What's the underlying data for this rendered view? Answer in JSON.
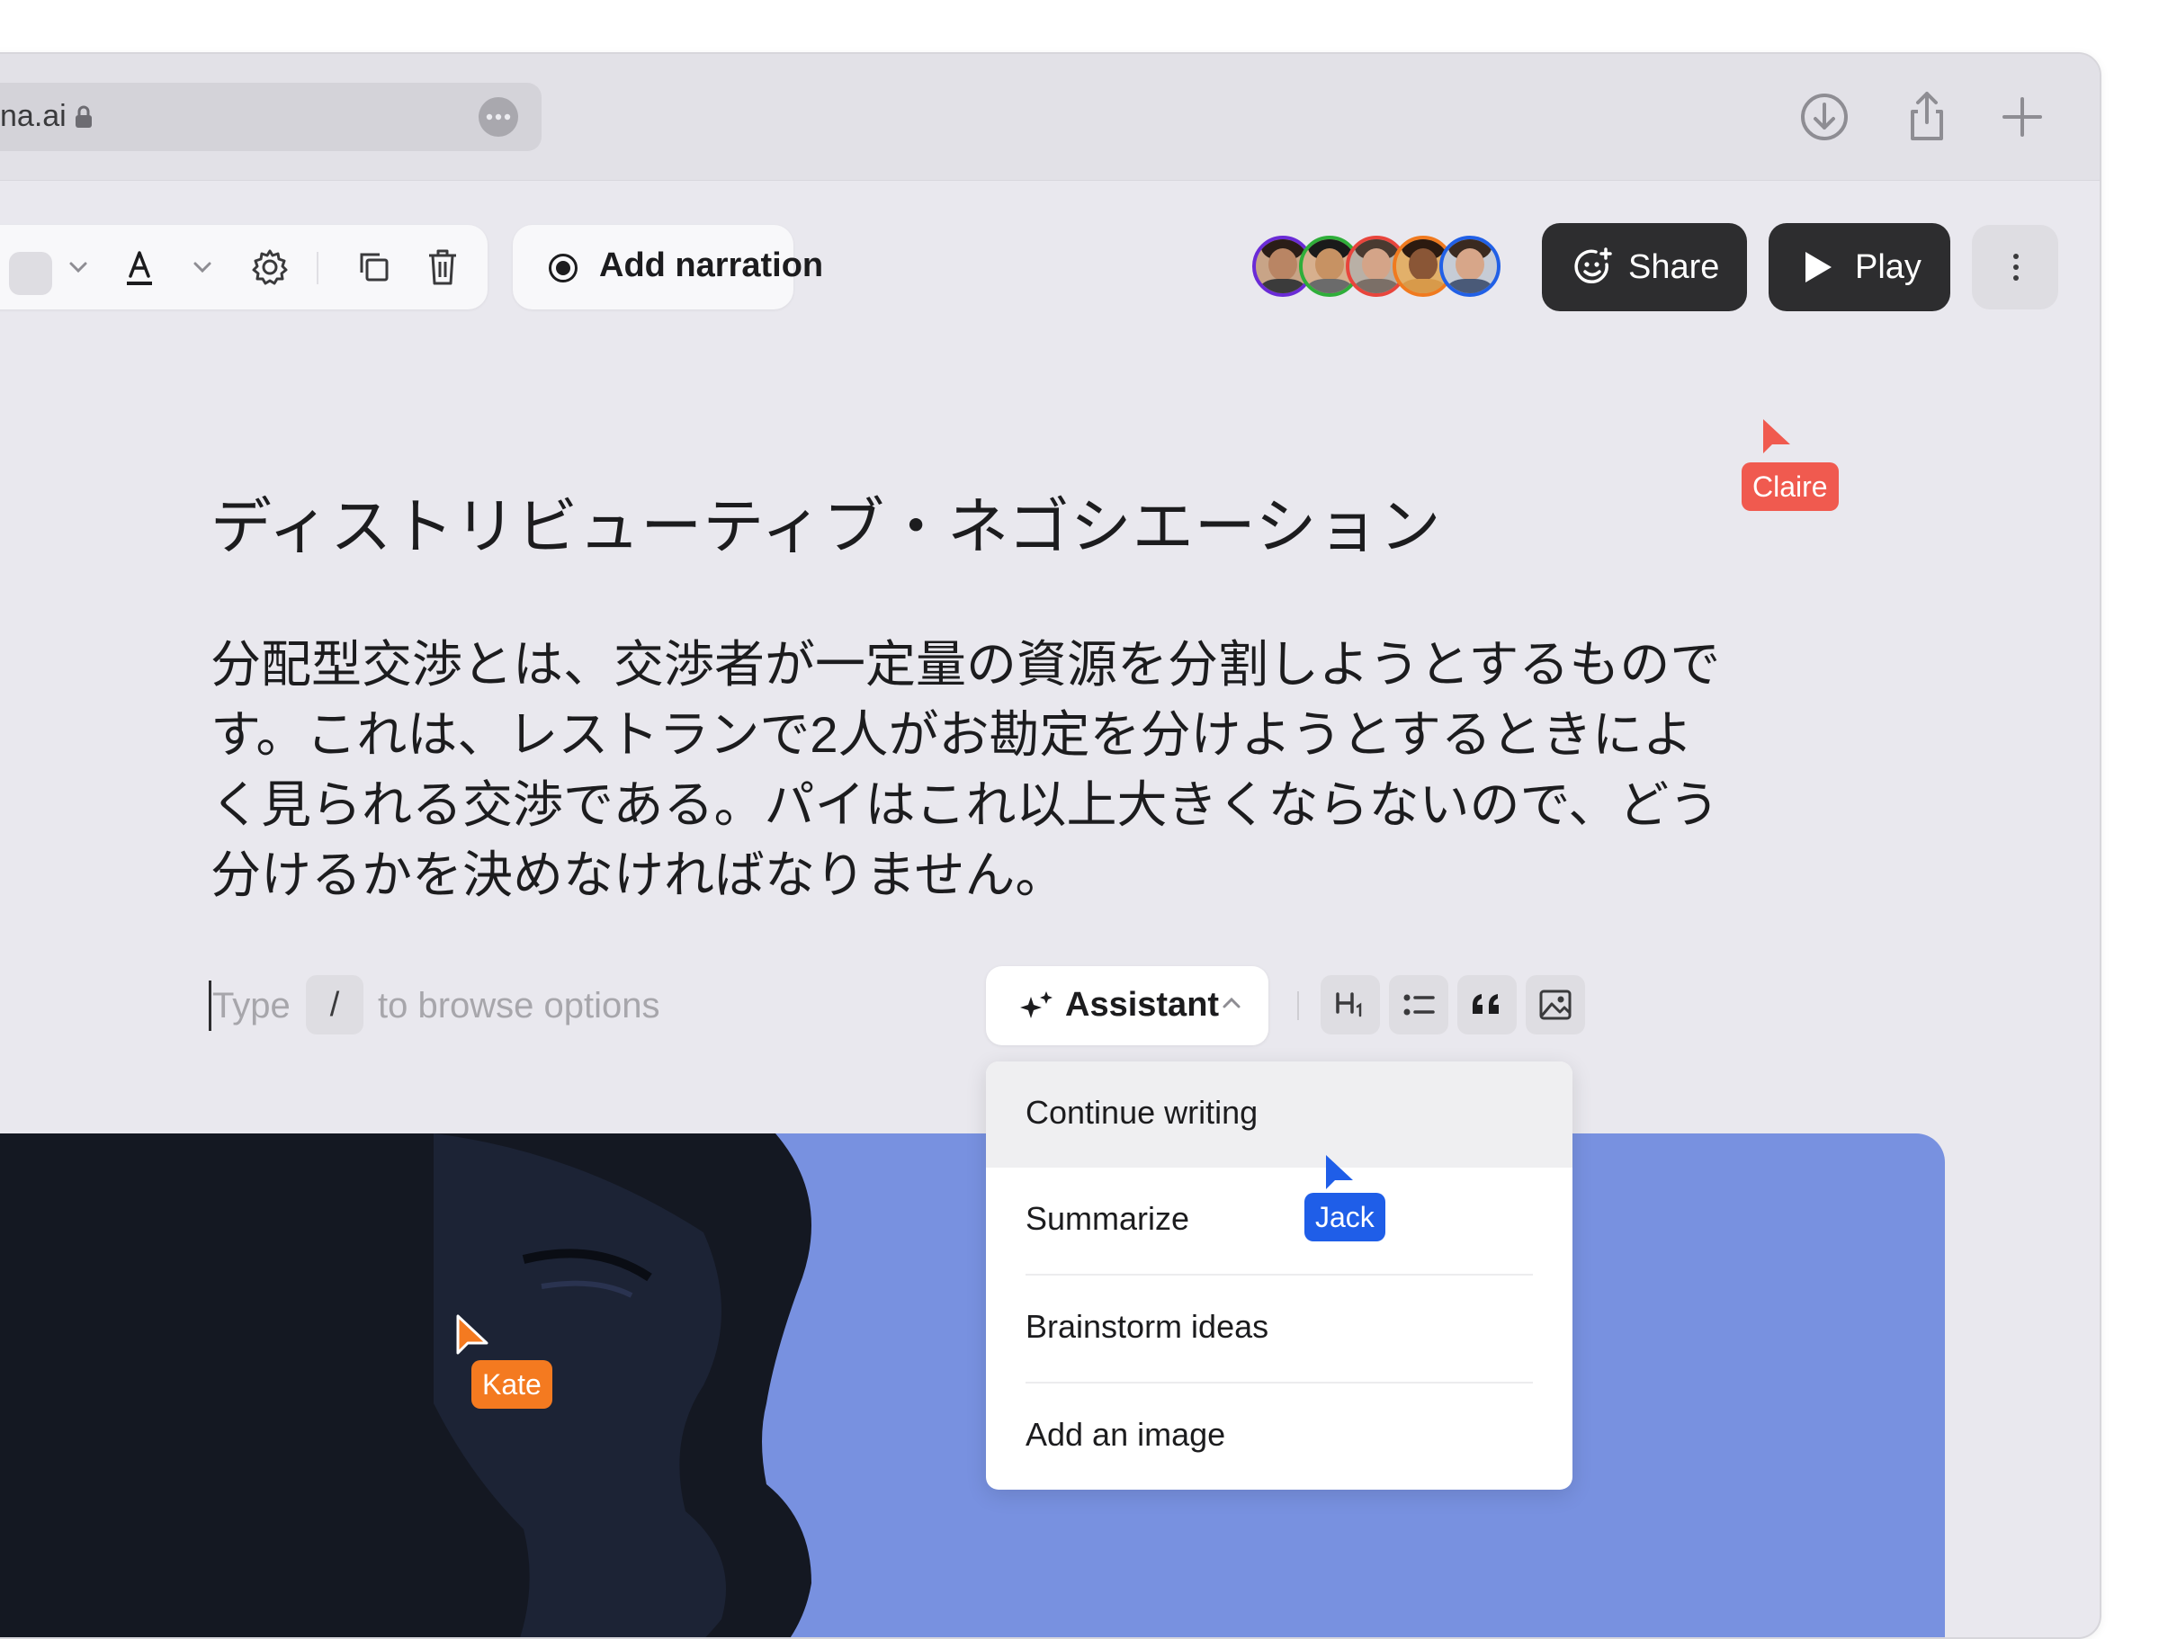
{
  "browser": {
    "url": "na.ai",
    "icons": [
      "lock-icon",
      "more-icon",
      "download-icon",
      "share-icon",
      "new-tab-icon"
    ]
  },
  "toolbar": {
    "icons": [
      "color-swatch",
      "chevron-down-icon",
      "text-color-icon",
      "chevron-down-icon",
      "gear-icon",
      "duplicate-icon",
      "trash-icon"
    ],
    "add_narration_label": "Add narration"
  },
  "header": {
    "share_label": "Share",
    "play_label": "Play",
    "collaborators": [
      "avatar-1",
      "avatar-2",
      "avatar-3",
      "avatar-4",
      "avatar-5"
    ]
  },
  "document": {
    "title": "ディストリビューティブ・ネゴシエーション",
    "paragraph_lines": [
      "分配型交渉とは、交渉者が一定量の資源を分割しようとするもので",
      "す。これは、レストランで2人がお勘定を分けようとするときによ",
      "く見られる交渉である。パイはこれ以上大きくならないので、どう",
      "分けるかを決めなければなりません。"
    ]
  },
  "editor": {
    "hint_type": "Type",
    "hint_key": "/",
    "hint_rest": "to browse options",
    "assistant_label": "Assistant",
    "format_icons": [
      "heading-icon",
      "bullet-list-icon",
      "quote-icon",
      "image-icon"
    ]
  },
  "assistant_menu": {
    "items": [
      "Continue writing",
      "Summarize",
      "Brainstorm ideas",
      "Add an image"
    ],
    "active_index": 0
  },
  "cursors": [
    {
      "name": "Claire",
      "color": "#f05a4f"
    },
    {
      "name": "Jack",
      "color": "#1f5ee8"
    },
    {
      "name": "Kate",
      "color": "#f47a20"
    }
  ],
  "colors": {
    "window_bg": "#e9e8ee",
    "dark_button": "#2d2d2f",
    "hero_bg": "#7891e0"
  }
}
